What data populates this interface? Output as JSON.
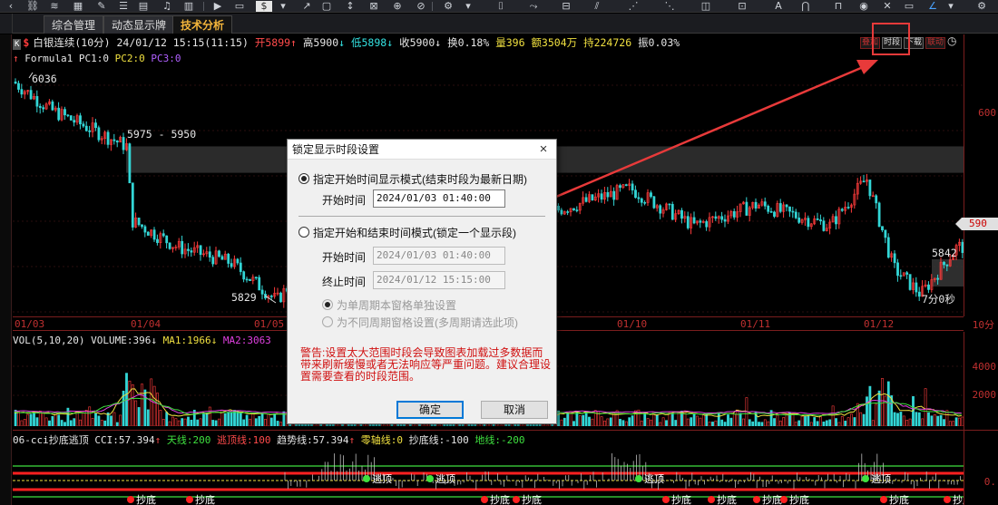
{
  "tabs": [
    {
      "label": "综合管理"
    },
    {
      "label": "动态显示牌"
    },
    {
      "label": "技术分析"
    }
  ],
  "header": {
    "k_badge": "K",
    "s_badge": "$",
    "name": "白银连续(10分)",
    "datetime": "24/01/12 15:15(11:15)",
    "open_label": "开5899",
    "open_arrow": "↑",
    "high_label": "高5900",
    "high_arrow": "↓",
    "low_label": "低5898",
    "low_arrow": "↓",
    "close_label": "收5900",
    "close_arrow": "↓",
    "turnover": "换0.18%",
    "volume": "量396",
    "amount": "额3504万",
    "position": "持224726",
    "amplitude": "振0.03%"
  },
  "formula": {
    "arrow": "↑",
    "name": "Formula1",
    "pc1": "PC1:0",
    "pc2": "PC2:0",
    "pc3": "PC3:0"
  },
  "right_buttons": {
    "b1": "叠加",
    "b2": "时段",
    "b3": "下载",
    "b4": "联动",
    "clock": "◷"
  },
  "price_chart": {
    "high_label": "6036",
    "range_label": "5975 - 5950",
    "low_label": "5829",
    "last_label": "5842",
    "countdown": "7分0秒",
    "axis_600": "600",
    "price_tag": "590",
    "bands": [
      [
        5950,
        5975
      ]
    ],
    "y_range": [
      5815,
      6050
    ]
  },
  "dates": [
    "01/03",
    "01/04",
    "01/05",
    "01/10",
    "01/11",
    "01/12"
  ],
  "period_label": "10分",
  "volume": {
    "name": "VOL(5,10,20)",
    "value": "VOLUME:396",
    "arrow1": "↓",
    "ma1": "MA1:1966",
    "arrow2": "↓",
    "ma2": "MA2:3063",
    "axis_4000": "4000",
    "axis_2000": "2000"
  },
  "cci": {
    "name": "06-cci抄底逃顶",
    "value": "CCI:57.394",
    "arrow": "↑",
    "tianxian": "天线:200",
    "taoding": "逃顶线:100",
    "qushi": "趋势线:57.394",
    "arrow2": "↑",
    "lingzhou": "零轴线:0",
    "chaodi": "抄底线:-100",
    "dixian": "地线:-200",
    "axis_0": "0.",
    "marker_taoding": "逃顶",
    "marker_chaodi": "抄底"
  },
  "dialog": {
    "title": "锁定显示时段设置",
    "close": "×",
    "mode1": "指定开始时间显示模式(结束时段为最新日期)",
    "start_label_1": "开始时间",
    "start_value_1": "2024/01/03 01:40:00",
    "mode2": "指定开始和结束时间模式(锁定一个显示段)",
    "start_label_2": "开始时间",
    "start_value_2": "2024/01/03 01:40:00",
    "end_label": "终止时间",
    "end_value": "2024/01/12 15:15:00",
    "sub1": "为单周期本窗格单独设置",
    "sub2": "为不同周期窗格设置(多周期请选此项)",
    "warning": "警告:设置太大范围时段会导致图表加载过多数据而带来刷新缓慢或者无法响应等严重问题。建议合理设置需要查看的时段范围。",
    "ok": "确定",
    "cancel": "取消"
  },
  "colors": {
    "up": "#ff3b3b",
    "down": "#33d6d6",
    "annotation": "#e83a3a"
  }
}
